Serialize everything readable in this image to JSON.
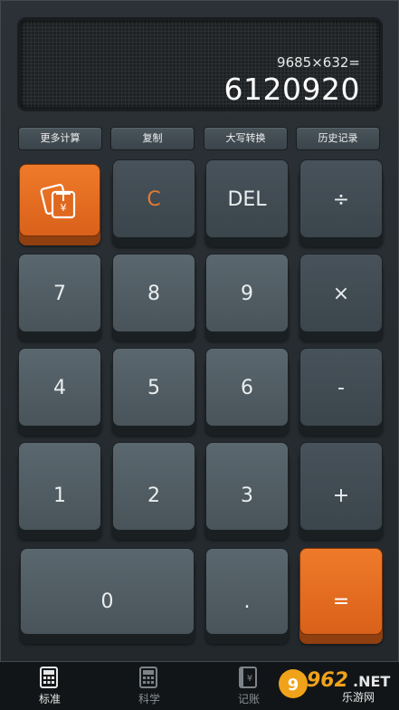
{
  "display": {
    "expression": "9685×632=",
    "result": "6120920"
  },
  "function_buttons": [
    "更多计算",
    "复制",
    "大写转换",
    "历史记录"
  ],
  "keys": {
    "money": "money-icon",
    "clear": "C",
    "delete": "DEL",
    "divide": "÷",
    "seven": "7",
    "eight": "8",
    "nine": "9",
    "multiply": "×",
    "four": "4",
    "five": "5",
    "six": "6",
    "minus": "-",
    "one": "1",
    "two": "2",
    "three": "3",
    "plus": "+",
    "zero": "0",
    "dot": ".",
    "equals": "="
  },
  "tabs": [
    {
      "label": "标准",
      "icon": "calculator-icon",
      "active": true
    },
    {
      "label": "科学",
      "icon": "calculator-icon",
      "active": false
    },
    {
      "label": "记账",
      "icon": "ledger-icon",
      "active": false
    }
  ],
  "watermark": {
    "number": "962",
    "suffix": ".NET",
    "text": "乐游网"
  },
  "colors": {
    "accent_orange": "#e8701f",
    "key_gray": "#56626a",
    "background": "#262b2f"
  }
}
